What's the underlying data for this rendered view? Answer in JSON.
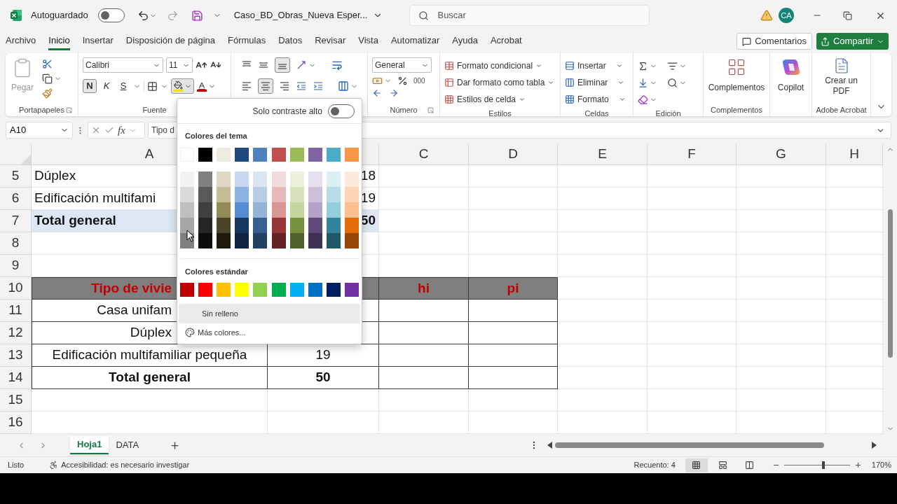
{
  "title_bar": {
    "autosave_label": "Autoguardado",
    "autosave_on": false,
    "file_name": "Caso_BD_Obras_Nueva Esper...",
    "search_placeholder": "Buscar",
    "avatar": "CA"
  },
  "menu": [
    {
      "label": "Archivo",
      "selected": false
    },
    {
      "label": "Inicio",
      "selected": true
    },
    {
      "label": "Insertar",
      "selected": false
    },
    {
      "label": "Disposición de página",
      "selected": false
    },
    {
      "label": "Fórmulas",
      "selected": false
    },
    {
      "label": "Datos",
      "selected": false
    },
    {
      "label": "Revisar",
      "selected": false
    },
    {
      "label": "Vista",
      "selected": false
    },
    {
      "label": "Automatizar",
      "selected": false
    },
    {
      "label": "Ayuda",
      "selected": false
    },
    {
      "label": "Acrobat",
      "selected": false
    }
  ],
  "comments_button": "Comentarios",
  "share_button": "Compartir",
  "ribbon": {
    "paste_label": "Pegar",
    "font_name": "Calibri",
    "font_size": "11",
    "format_buttons": [
      {
        "label": "N",
        "selected": true
      },
      {
        "label": "K",
        "selected": false
      },
      {
        "label": "S",
        "selected": false
      }
    ],
    "fill_button_pressed": true,
    "number_format": "General",
    "thousands_label": "000",
    "styles": [
      "Formato condicional",
      "Dar formato como tabla",
      "Estilos de celda"
    ],
    "cells": [
      "Insertar",
      "Eliminar",
      "Formato"
    ],
    "addins_label": "Complementos",
    "copilot_label": "Copilot",
    "pdf_label": "Crear un PDF",
    "group_labels": [
      "Portapapeles",
      "Fuente",
      "Número",
      "Estilos",
      "Celdas",
      "Edición",
      "Complementos",
      "Adobe Acrobat"
    ]
  },
  "formula_bar": {
    "name_box": "A10",
    "function_label": "fx",
    "value": "Tipo d"
  },
  "column_headers": [
    "A",
    "C",
    "D",
    "E",
    "F",
    "G",
    "H"
  ],
  "rows": [
    {
      "number": "5",
      "kind": "list",
      "col_a": "Dúplex",
      "col_b": "18"
    },
    {
      "number": "6",
      "kind": "list",
      "col_a": "Edificación multifami",
      "col_b": "19"
    },
    {
      "number": "7",
      "kind": "list_total",
      "col_a": "Total general",
      "col_b": "50"
    },
    {
      "number": "8",
      "kind": "empty"
    },
    {
      "number": "9",
      "kind": "empty"
    },
    {
      "number": "10",
      "kind": "table_header",
      "col_a": "Tipo de vivie",
      "col_a_cut": true,
      "col_c": "hi",
      "col_d": "pi"
    },
    {
      "number": "11",
      "kind": "table_row",
      "col_a": "Casa unifam",
      "col_a_cut": true
    },
    {
      "number": "12",
      "kind": "table_row",
      "col_a": "Dúplex",
      "col_a_cut": true
    },
    {
      "number": "13",
      "kind": "table_row",
      "col_a": "Edificación multifamiliar pequeña",
      "col_b": "19"
    },
    {
      "number": "14",
      "kind": "table_total",
      "col_a": "Total general",
      "col_b": "50"
    },
    {
      "number": "15",
      "kind": "empty"
    },
    {
      "number": "16",
      "kind": "empty"
    }
  ],
  "color_picker": {
    "high_contrast_label": "Solo contraste alto",
    "high_contrast_on": false,
    "theme_title": "Colores del tema",
    "theme_colors": [
      {
        "color": "#ffffff"
      },
      {
        "color": "#000000"
      },
      {
        "color": "#eeece1"
      },
      {
        "color": "#1f497d"
      },
      {
        "color": "#4f81bd"
      },
      {
        "color": "#c0504d"
      },
      {
        "color": "#9bbb59"
      },
      {
        "color": "#8064a2"
      },
      {
        "color": "#4bacc6"
      },
      {
        "color": "#f79646"
      }
    ],
    "theme_shades": [
      {
        "shades": [
          {
            "color": "#f2f2f2"
          },
          {
            "color": "#d9d9d9"
          },
          {
            "color": "#bfbfbf"
          },
          {
            "color": "#a6a6a6"
          },
          {
            "color": "#808080"
          }
        ]
      },
      {
        "shades": [
          {
            "color": "#808080"
          },
          {
            "color": "#595959"
          },
          {
            "color": "#404040"
          },
          {
            "color": "#262626"
          },
          {
            "color": "#0d0d0d"
          }
        ]
      },
      {
        "shades": [
          {
            "color": "#ddd9c4"
          },
          {
            "color": "#c4bd97"
          },
          {
            "color": "#948a54"
          },
          {
            "color": "#4a452a"
          },
          {
            "color": "#1d1b10"
          }
        ]
      },
      {
        "shades": [
          {
            "color": "#c6d9f0"
          },
          {
            "color": "#8db3e2"
          },
          {
            "color": "#548dd4"
          },
          {
            "color": "#17365d"
          },
          {
            "color": "#0f243e"
          }
        ]
      },
      {
        "shades": [
          {
            "color": "#dbe5f1"
          },
          {
            "color": "#b8cce4"
          },
          {
            "color": "#95b3d7"
          },
          {
            "color": "#366092"
          },
          {
            "color": "#244061"
          }
        ]
      },
      {
        "shades": [
          {
            "color": "#f2dcdb"
          },
          {
            "color": "#e6b8b7"
          },
          {
            "color": "#da9694"
          },
          {
            "color": "#953734"
          },
          {
            "color": "#632423"
          }
        ]
      },
      {
        "shades": [
          {
            "color": "#ebf1dd"
          },
          {
            "color": "#d7e3bc"
          },
          {
            "color": "#c3d69b"
          },
          {
            "color": "#76923c"
          },
          {
            "color": "#4f6128"
          }
        ]
      },
      {
        "shades": [
          {
            "color": "#e5e0ec"
          },
          {
            "color": "#ccc1d9"
          },
          {
            "color": "#b2a2c7"
          },
          {
            "color": "#5f497a"
          },
          {
            "color": "#3f3151"
          }
        ]
      },
      {
        "shades": [
          {
            "color": "#dbeef3"
          },
          {
            "color": "#b7dde8"
          },
          {
            "color": "#92cddc"
          },
          {
            "color": "#31859b"
          },
          {
            "color": "#205867"
          }
        ]
      },
      {
        "shades": [
          {
            "color": "#fdeada"
          },
          {
            "color": "#fbd5b5"
          },
          {
            "color": "#fac08f"
          },
          {
            "color": "#e36c09"
          },
          {
            "color": "#974806"
          }
        ]
      }
    ],
    "standard_title": "Colores estándar",
    "standard_colors": [
      {
        "color": "#c00000"
      },
      {
        "color": "#ff0000"
      },
      {
        "color": "#ffc000"
      },
      {
        "color": "#ffff00"
      },
      {
        "color": "#92d050"
      },
      {
        "color": "#00b050"
      },
      {
        "color": "#00b0f0"
      },
      {
        "color": "#0070c0"
      },
      {
        "color": "#002060"
      },
      {
        "color": "#7030a0"
      }
    ],
    "no_fill": "Sin relleno",
    "more_colors": "Más colores..."
  },
  "sheets": [
    {
      "label": "Hoja1",
      "selected": true
    },
    {
      "label": "DATA",
      "selected": false
    }
  ],
  "status_bar": {
    "status": "Listo",
    "accessibility": "Accesibilidad: es necesario investigar",
    "count": "Recuento: 4",
    "views": [
      {
        "kind": "normal",
        "selected": true
      },
      {
        "kind": "page_layout",
        "selected": false
      },
      {
        "kind": "page_break",
        "selected": false
      }
    ],
    "zoom": {
      "level": 0.6,
      "label": "170%"
    }
  }
}
